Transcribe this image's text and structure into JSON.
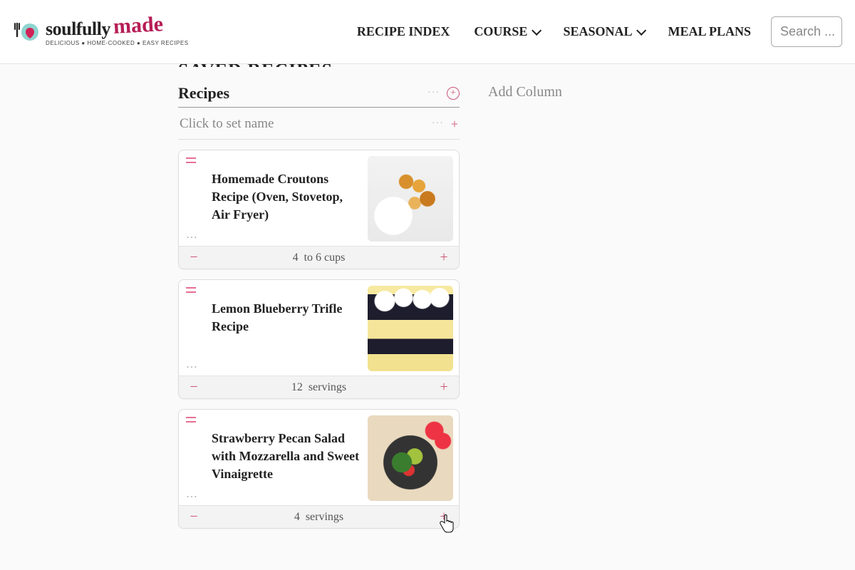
{
  "logo": {
    "word1": "soulfully",
    "word2": "made",
    "tagline": "DELICIOUS ● HOME-COOKED ● EASY RECIPES"
  },
  "nav": {
    "recipe_index": "RECIPE INDEX",
    "course": "COURSE",
    "seasonal": "SEASONAL",
    "meal_plans": "MEAL PLANS"
  },
  "search": {
    "placeholder": "Search ..."
  },
  "page_title": "SAVED RECIPES",
  "column": {
    "title": "Recipes",
    "set_name_placeholder": "Click to set name"
  },
  "add_column_label": "Add Column",
  "cards": [
    {
      "title": "Homemade Croutons Recipe (Oven, Stovetop, Air Fryer)",
      "servings_num": "4",
      "servings_unit": "to 6 cups",
      "thumb": "croutons"
    },
    {
      "title": "Lemon Blueberry Trifle Recipe",
      "servings_num": "12",
      "servings_unit": "servings",
      "thumb": "trifle"
    },
    {
      "title": "Strawberry Pecan Salad with Mozzarella and Sweet Vinaigrette",
      "servings_num": "4",
      "servings_unit": "servings",
      "thumb": "salad"
    }
  ]
}
